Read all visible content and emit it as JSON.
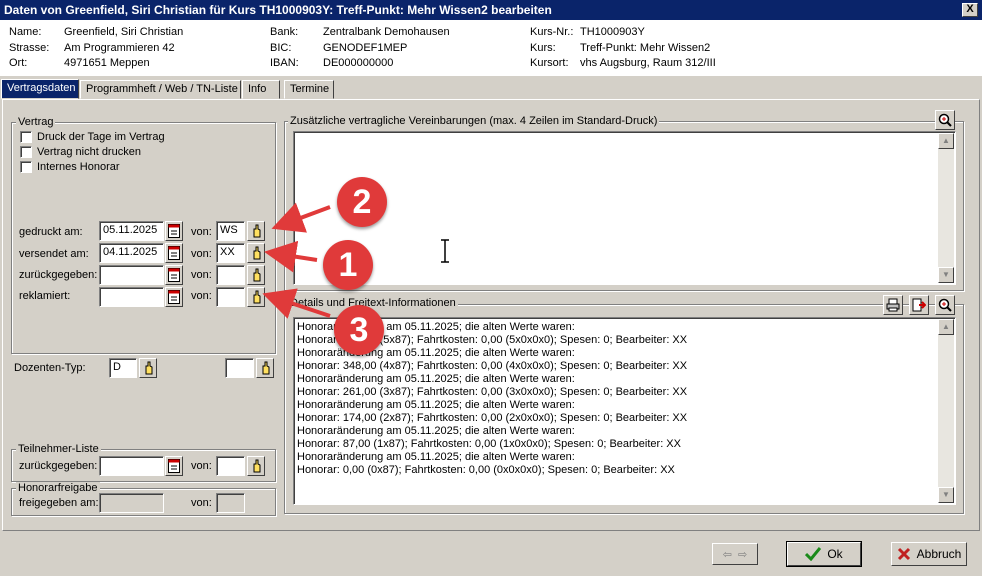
{
  "window": {
    "title": "Daten von Greenfield, Siri Christian für Kurs TH1000903Y: Treff-Punkt: Mehr Wissen2 bearbeiten",
    "close": "X"
  },
  "info": {
    "name_label": "Name:",
    "name_value": "Greenfield, Siri Christian",
    "strasse_label": "Strasse:",
    "strasse_value": "Am Programmieren 42",
    "ort_label": "Ort:",
    "ort_value": "4971651 Meppen",
    "bank_label": "Bank:",
    "bank_value": "Zentralbank Demohausen",
    "bic_label": "BIC:",
    "bic_value": "GENODEF1MEP",
    "iban_label": "IBAN:",
    "iban_value": "DE000000000",
    "kursnr_label": "Kurs-Nr.:",
    "kursnr_value": "TH1000903Y",
    "kurs_label": "Kurs:",
    "kurs_value": "Treff-Punkt: Mehr Wissen2",
    "kursort_label": "Kursort:",
    "kursort_value": "vhs Augsburg, Raum 312/III"
  },
  "tabs": [
    "Vertragsdaten",
    "Programmheft / Web / TN-Liste",
    "Info",
    "Termine"
  ],
  "vertrag": {
    "title": "Vertrag",
    "checkboxes": [
      "Druck der Tage im Vertrag",
      "Vertrag nicht drucken",
      "Internes Honorar"
    ],
    "rows": [
      {
        "label": "gedruckt am:",
        "date": "05.11.2025",
        "von_label": "von:",
        "von": "WS"
      },
      {
        "label": "versendet am:",
        "date": "04.11.2025",
        "von_label": "von:",
        "von": "XX"
      },
      {
        "label": "zurückgegeben:",
        "date": "",
        "von_label": "von:",
        "von": ""
      },
      {
        "label": "reklamiert:",
        "date": "",
        "von_label": "von:",
        "von": ""
      }
    ]
  },
  "dozenten": {
    "label": "Dozenten-Typ:",
    "value": "D",
    "extra": ""
  },
  "teilnehmer": {
    "title": "Teilnehmer-Liste",
    "label": "zurückgegeben:",
    "von_label": "von:"
  },
  "honorar": {
    "title": "Honorarfreigabe",
    "label": "freigegeben am:",
    "von_label": "von:"
  },
  "vereinbarungen": {
    "title": "Zusätzliche vertragliche Vereinbarungen (max. 4 Zeilen im Standard-Druck)"
  },
  "details": {
    "title": "Details und Freitext-Informationen",
    "lines": [
      "Honoraränderung am 05.11.2025; die alten Werte waren:",
      "Honorar: 435,00 (5x87); Fahrtkosten: 0,00 (5x0x0x0); Spesen: 0; Bearbeiter: XX",
      "Honoraränderung am 05.11.2025; die alten Werte waren:",
      "Honorar: 348,00 (4x87); Fahrtkosten: 0,00 (4x0x0x0); Spesen: 0; Bearbeiter: XX",
      "Honoraränderung am 05.11.2025; die alten Werte waren:",
      "Honorar: 261,00 (3x87); Fahrtkosten: 0,00 (3x0x0x0); Spesen: 0; Bearbeiter: XX",
      "Honoraränderung am 05.11.2025; die alten Werte waren:",
      "Honorar: 174,00 (2x87); Fahrtkosten: 0,00 (2x0x0x0); Spesen: 0; Bearbeiter: XX",
      "Honoraränderung am 05.11.2025; die alten Werte waren:",
      "Honorar: 87,00 (1x87); Fahrtkosten: 0,00 (1x0x0x0); Spesen: 0; Bearbeiter: XX",
      "Honoraränderung am 05.11.2025; die alten Werte waren:",
      "Honorar: 0,00 (0x87); Fahrtkosten: 0,00 (0x0x0x0); Spesen: 0; Bearbeiter: XX"
    ]
  },
  "buttons": {
    "ok": "Ok",
    "cancel": "Abbruch"
  },
  "annotations": [
    "2",
    "1",
    "3"
  ],
  "colors": {
    "titlebar": "#0a246a",
    "badge": "#e03a3a",
    "ok_check": "#1a8a1a",
    "cancel_x": "#c02020"
  }
}
